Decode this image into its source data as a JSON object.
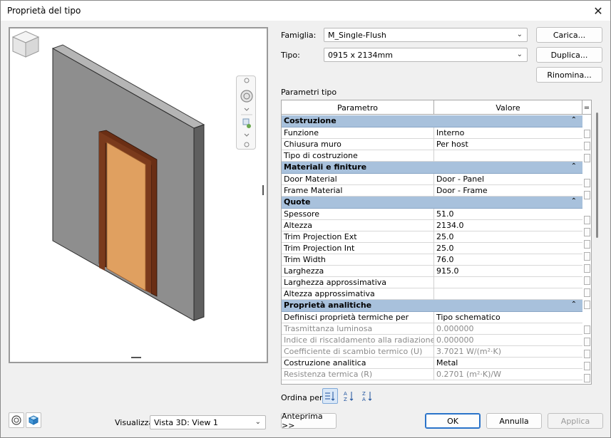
{
  "window": {
    "title": "Proprietà del tipo"
  },
  "form": {
    "famiglia_label": "Famiglia:",
    "famiglia_value": "M_Single-Flush",
    "tipo_label": "Tipo:",
    "tipo_value": "0915 x 2134mm",
    "carica_label": "Carica...",
    "duplica_label": "Duplica...",
    "rinomina_label": "Rinomina...",
    "parametri_label": "Parametri tipo"
  },
  "table": {
    "col_param": "Parametro",
    "col_value": "Valore",
    "col_lock": "=",
    "groups": [
      {
        "name": "Costruzione",
        "collapse": "⌃",
        "rows": [
          {
            "k": "Funzione",
            "v": "Interno"
          },
          {
            "k": "Chiusura muro",
            "v": "Per host"
          },
          {
            "k": "Tipo di costruzione",
            "v": ""
          }
        ]
      },
      {
        "name": "Materiali e finiture",
        "collapse": "⌃",
        "rows": [
          {
            "k": "Door Material",
            "v": "Door - Panel"
          },
          {
            "k": "Frame Material",
            "v": "Door - Frame"
          }
        ]
      },
      {
        "name": "Quote",
        "collapse": "⌃",
        "rows": [
          {
            "k": "Spessore",
            "v": "51.0"
          },
          {
            "k": "Altezza",
            "v": "2134.0"
          },
          {
            "k": "Trim Projection Ext",
            "v": "25.0"
          },
          {
            "k": "Trim Projection Int",
            "v": "25.0"
          },
          {
            "k": "Trim Width",
            "v": "76.0"
          },
          {
            "k": "Larghezza",
            "v": "915.0"
          },
          {
            "k": "Larghezza approssimativa",
            "v": ""
          },
          {
            "k": "Altezza approssimativa",
            "v": ""
          }
        ]
      },
      {
        "name": "Proprietà analitiche",
        "collapse": "⌃",
        "rows": [
          {
            "k": "Definisci proprietà termiche per",
            "v": "Tipo schematico"
          },
          {
            "k": "Trasmittanza luminosa",
            "v": "0.000000",
            "dim": true
          },
          {
            "k": "Indice di riscaldamento alla radiazione solare",
            "v": "0.000000",
            "dim": true
          },
          {
            "k": "Coefficiente di scambio termico (U)",
            "v": "3.7021 W/(m²·K)",
            "dim": true
          },
          {
            "k": "Costruzione analitica",
            "v": "Metal"
          },
          {
            "k": "Resistenza termica (R)",
            "v": "0.2701 (m²·K)/W",
            "dim": true
          }
        ]
      }
    ]
  },
  "sort": {
    "label": "Ordina per:"
  },
  "bottom": {
    "visualizza_label": "Visualizza:",
    "visualizza_value": "Vista 3D: View 1",
    "anteprima_label": "Anteprima >>",
    "ok_label": "OK",
    "annulla_label": "Annulla",
    "applica_label": "Applica"
  },
  "colors": {
    "group_header": "#a8c1dc",
    "wall_front": "#8e8e8e",
    "wall_side": "#5f5f5f",
    "door_panel": "#e0a060",
    "door_frame": "#6a2e14",
    "accent": "#2a73c9"
  }
}
